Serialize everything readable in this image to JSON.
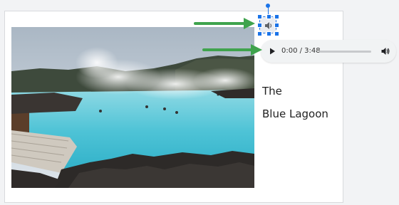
{
  "slide": {
    "title_line1": "The",
    "title_line2": "Blue Lagoon"
  },
  "audio_player": {
    "time_display": "0:00 / 3:48",
    "progress": 0.0
  },
  "icons": {
    "selected_audio": "speaker-icon",
    "play": "play-icon",
    "volume": "volume-icon",
    "annotation_arrows": "arrow-right"
  },
  "colors": {
    "selection": "#1a73e8",
    "arrow": "#3fa34d",
    "player_bg": "#f1f3f4",
    "lagoon_water": "#56c8d8"
  }
}
